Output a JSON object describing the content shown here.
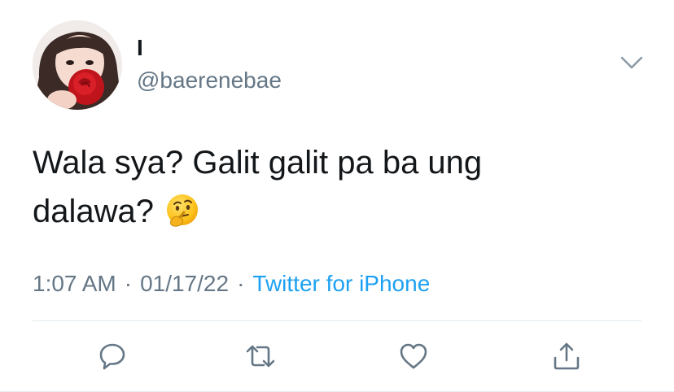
{
  "user": {
    "display_name": "I",
    "handle": "@baerenebae"
  },
  "tweet": {
    "text": "Wala sya? Galit galit pa ba ung dalawa?",
    "emoji": "thinking-face-emoji"
  },
  "meta": {
    "time": "1:07 AM",
    "separator": "·",
    "date": "01/17/22",
    "source": "Twitter for iPhone"
  },
  "actions": {
    "reply_icon": "reply-icon",
    "retweet_icon": "retweet-icon",
    "like_icon": "like-icon",
    "share_icon": "share-icon"
  },
  "colors": {
    "primary_text": "#14171a",
    "secondary_text": "#657786",
    "link": "#1da1f2",
    "icon": "#657786",
    "divider": "#e1e8ed"
  }
}
